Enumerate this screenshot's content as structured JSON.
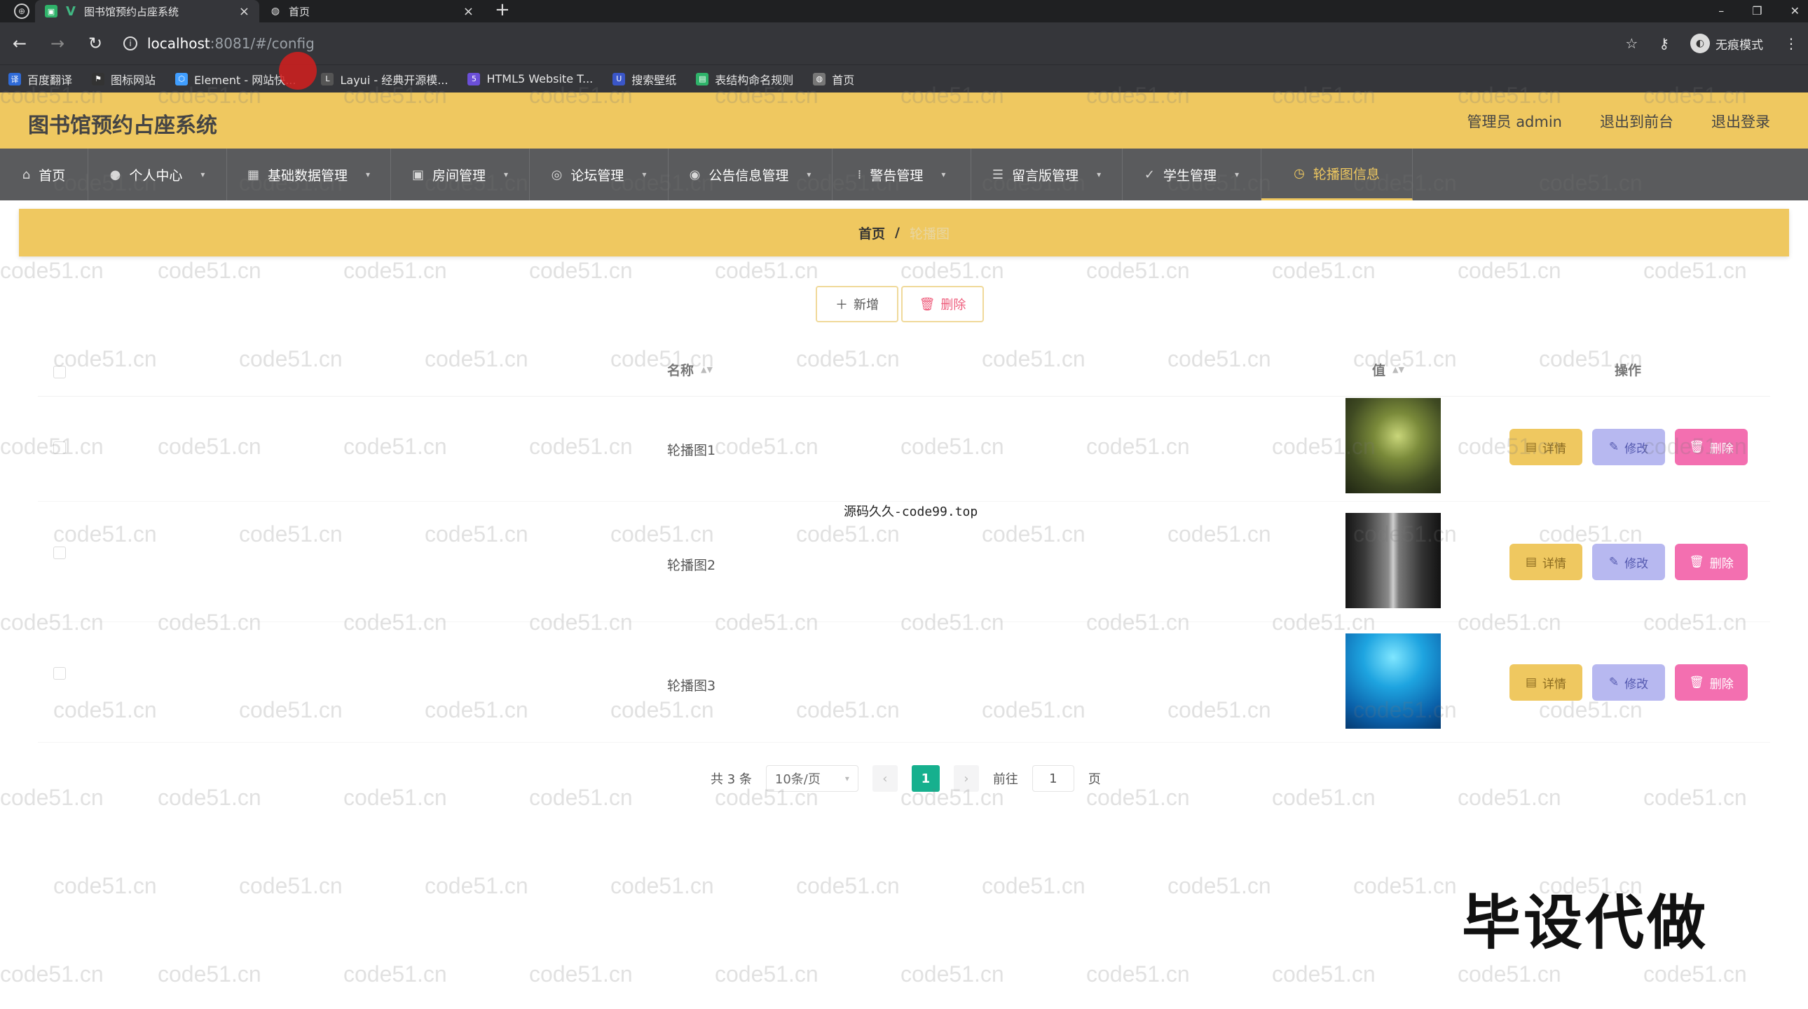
{
  "browser": {
    "tabs": [
      {
        "title": "图书馆预约占座系统",
        "active": true
      },
      {
        "title": "首页",
        "active": false
      }
    ],
    "url_host": "localhost",
    "url_path": ":8081/#/config",
    "incognito_label": "无痕模式",
    "bookmarks": [
      {
        "label": "百度翻译",
        "color": "#2f6bd8"
      },
      {
        "label": "图标网站",
        "color": "#333333"
      },
      {
        "label": "Element - 网站快...",
        "color": "#409eff"
      },
      {
        "label": "Layui - 经典开源模...",
        "color": "#555555"
      },
      {
        "label": "HTML5 Website T...",
        "color": "#6b4fd8"
      },
      {
        "label": "搜索壁纸",
        "color": "#3a56c8"
      },
      {
        "label": "表结构命名规则",
        "color": "#2fb36a"
      },
      {
        "label": "首页",
        "color": "#777777"
      }
    ]
  },
  "header": {
    "title": "图书馆预约占座系统",
    "user": "管理员 admin",
    "front_link": "退出到前台",
    "logout": "退出登录"
  },
  "nav": [
    {
      "label": "首页",
      "icon": "home-icon",
      "glyph": "⌂",
      "caret": false,
      "active": false
    },
    {
      "label": "个人中心",
      "icon": "user-icon",
      "glyph": "●",
      "caret": true,
      "active": false
    },
    {
      "label": "基础数据管理",
      "icon": "grid-icon",
      "glyph": "▦",
      "caret": true,
      "active": false
    },
    {
      "label": "房间管理",
      "icon": "room-icon",
      "glyph": "▣",
      "caret": true,
      "active": false
    },
    {
      "label": "论坛管理",
      "icon": "forum-icon",
      "glyph": "◎",
      "caret": true,
      "active": false
    },
    {
      "label": "公告信息管理",
      "icon": "notice-icon",
      "glyph": "◉",
      "caret": true,
      "active": false
    },
    {
      "label": "警告管理",
      "icon": "warning-icon",
      "glyph": "⁞",
      "caret": true,
      "active": false
    },
    {
      "label": "留言版管理",
      "icon": "message-icon",
      "glyph": "☰",
      "caret": true,
      "active": false
    },
    {
      "label": "学生管理",
      "icon": "student-icon",
      "glyph": "✓",
      "caret": true,
      "active": false
    },
    {
      "label": "轮播图信息",
      "icon": "carousel-icon",
      "glyph": "◷",
      "caret": false,
      "active": true
    }
  ],
  "breadcrumb": {
    "home": "首页",
    "separator": "/",
    "current": "轮播图"
  },
  "actions": {
    "add": "新增",
    "delete": "删除"
  },
  "table": {
    "columns": {
      "name": "名称",
      "value": "值",
      "ops": "操作"
    },
    "rows": [
      {
        "name": "轮播图1",
        "image": "forest-image"
      },
      {
        "name": "轮播图2",
        "image": "corridor-image"
      },
      {
        "name": "轮播图3",
        "image": "underwater-image"
      }
    ],
    "op_labels": {
      "detail": "详情",
      "edit": "修改",
      "remove": "删除"
    }
  },
  "pagination": {
    "total": "共 3 条",
    "page_size": "10条/页",
    "current_page": "1",
    "goto_label": "前往",
    "goto_value": "1",
    "page_suffix": "页"
  },
  "overlay": {
    "caption": "源码久久-code99.top",
    "stamp": "毕设代做",
    "watermark": "code51.cn"
  }
}
